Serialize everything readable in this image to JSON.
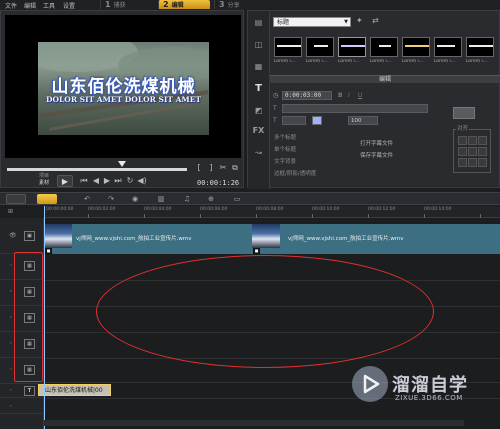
{
  "menu": {
    "items": [
      "文件",
      "编辑",
      "工具",
      "设置"
    ],
    "steps": [
      {
        "num": "1",
        "label": "捕获"
      },
      {
        "num": "2",
        "label": "编辑"
      },
      {
        "num": "3",
        "label": "分享"
      }
    ],
    "active_step": "编辑"
  },
  "preview": {
    "title_cn": "山东佰伦洗煤机械",
    "title_en": "DOLOR SIT AMET DOLOR SIT AMET",
    "mode_labels": [
      "项目",
      "素材"
    ],
    "timecode": "00:00:1:26",
    "playback_progress": 0.6
  },
  "library": {
    "category": "标题",
    "thumbnail_label": "Lorem i...",
    "thumbnail_count": 7
  },
  "edit_panel": {
    "header": "编辑",
    "duration": "0:00:03:00",
    "size_value": "100",
    "open_subtitle": "打开字幕文件",
    "save_subtitle": "保存字幕文件",
    "align_label": "对齐",
    "options": [
      "多个标题",
      "单个标题",
      "文字背景",
      "边框/阴影/透明度"
    ]
  },
  "timeline": {
    "ruler_labels": [
      "00:00:00:00",
      "00:00:02:00",
      "00:00:04:00",
      "00:00:06:00",
      "00:00:08:00",
      "00:00:10:00",
      "00:00:12:00",
      "00:00:14:00"
    ],
    "clip_names": [
      "vj师网_www.vjshi.com_航拍工业宣传片.wmv",
      "vj师网_www.vjshi.com_航拍工业宣传片.wmv"
    ],
    "title_clip": "山东佰伦洗煤机械|00"
  },
  "watermark": {
    "name_cn": "溜溜自学",
    "url": "ZIXUE.3D66.COM"
  },
  "colors": {
    "accent": "#e3a82a",
    "video_track": "#3c6f82",
    "annotation": "#e03030"
  }
}
